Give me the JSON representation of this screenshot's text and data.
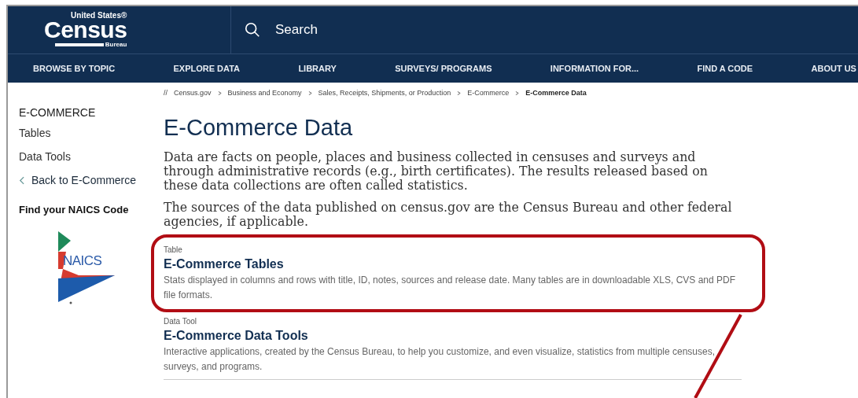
{
  "logo": {
    "top": "United States®",
    "name": "Census",
    "sub": "Bureau"
  },
  "search": {
    "placeholder": "Search"
  },
  "nav": [
    "BROWSE BY TOPIC",
    "EXPLORE DATA",
    "LIBRARY",
    "SURVEYS/ PROGRAMS",
    "INFORMATION FOR...",
    "FIND A CODE",
    "ABOUT US"
  ],
  "sidebar": {
    "heading": "E-COMMERCE",
    "items": [
      {
        "label": "Tables",
        "kind": "link"
      },
      {
        "label": "Data Tools",
        "kind": "link"
      },
      {
        "label": "Back to E-Commerce",
        "kind": "back"
      }
    ],
    "naics_heading": "Find your NAICS Code",
    "naics_logo": "NAICS"
  },
  "breadcrumb": {
    "separator": "//",
    "items": [
      {
        "label": "Census.gov",
        "current": false
      },
      {
        "label": "Business and Economy",
        "current": false
      },
      {
        "label": "Sales, Receipts, Shipments, or Production",
        "current": false
      },
      {
        "label": "E-Commerce",
        "current": false
      },
      {
        "label": "E-Commerce Data",
        "current": true
      }
    ]
  },
  "title": "E-Commerce Data",
  "paragraphs": [
    "Data are facts on people, places and business collected in censuses and surveys and through administrative records (e.g., birth certificates). The results released based on these data collections are often called statistics.",
    "The sources of the data published on census.gov are the Census Bureau and other federal agencies, if applicable."
  ],
  "resources": [
    {
      "type": "Table",
      "title": "E-Commerce Tables",
      "description": "Stats displayed in columns and rows with title, ID, notes, sources and release date. Many tables are in downloadable XLS, CVS and PDF file formats.",
      "highlighted": true
    },
    {
      "type": "Data Tool",
      "title": "E-Commerce Data Tools",
      "description": "Interactive applications, created by the Census Bureau, to help you customize, and even visualize, statistics from multiple censuses, surveys, and programs.",
      "highlighted": false
    }
  ]
}
